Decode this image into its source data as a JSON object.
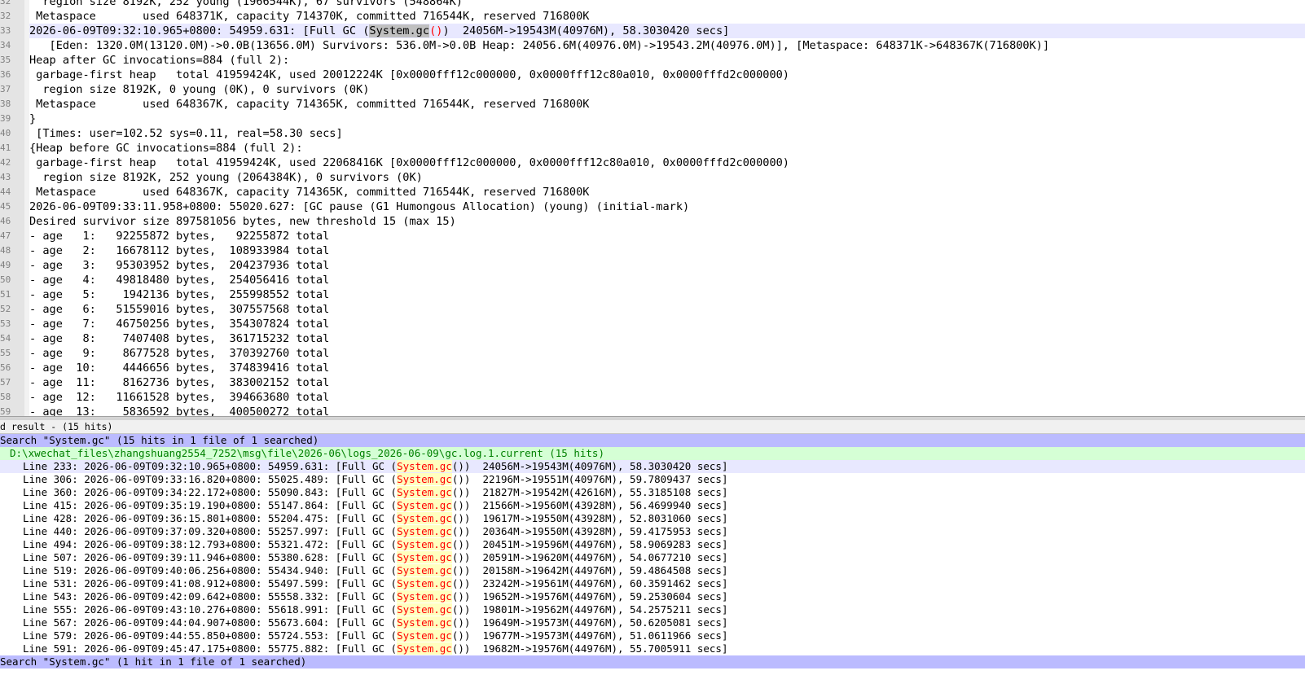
{
  "editor": {
    "current_line_number": "33",
    "lines": [
      {
        "n": "32",
        "text": "  region size 8192K, 252 young (1966544K), 67 survivors (548864K)"
      },
      {
        "n": "32",
        "text": " Metaspace       used 648371K, capacity 714370K, committed 716544K, reserved 716800K"
      },
      {
        "n": "33",
        "pre": "2026-06-09T09:32:10.965+0800: 54959.631: [Full GC (",
        "hl": "System.gc",
        "paren": "()",
        "post": ")  24056M->19543M(40976M), 58.3030420 secs]"
      },
      {
        "n": "34",
        "text": "   [Eden: 1320.0M(13120.0M)->0.0B(13656.0M) Survivors: 536.0M->0.0B Heap: 24056.6M(40976.0M)->19543.2M(40976.0M)], [Metaspace: 648371K->648367K(716800K)]"
      },
      {
        "n": "35",
        "text": "Heap after GC invocations=884 (full 2):"
      },
      {
        "n": "36",
        "text": " garbage-first heap   total 41959424K, used 20012224K [0x0000fff12c000000, 0x0000fff12c80a010, 0x0000fffd2c000000)"
      },
      {
        "n": "37",
        "text": "  region size 8192K, 0 young (0K), 0 survivors (0K)"
      },
      {
        "n": "38",
        "text": " Metaspace       used 648367K, capacity 714365K, committed 716544K, reserved 716800K"
      },
      {
        "n": "39",
        "text": "}"
      },
      {
        "n": "40",
        "text": " [Times: user=102.52 sys=0.11, real=58.30 secs]"
      },
      {
        "n": "41",
        "text": "{Heap before GC invocations=884 (full 2):"
      },
      {
        "n": "42",
        "text": " garbage-first heap   total 41959424K, used 22068416K [0x0000fff12c000000, 0x0000fff12c80a010, 0x0000fffd2c000000)"
      },
      {
        "n": "43",
        "text": "  region size 8192K, 252 young (2064384K), 0 survivors (0K)"
      },
      {
        "n": "44",
        "text": " Metaspace       used 648367K, capacity 714365K, committed 716544K, reserved 716800K"
      },
      {
        "n": "45",
        "text": "2026-06-09T09:33:11.958+0800: 55020.627: [GC pause (G1 Humongous Allocation) (young) (initial-mark)"
      },
      {
        "n": "46",
        "text": "Desired survivor size 897581056 bytes, new threshold 15 (max 15)"
      },
      {
        "n": "47",
        "text": "- age   1:   92255872 bytes,   92255872 total"
      },
      {
        "n": "48",
        "text": "- age   2:   16678112 bytes,  108933984 total"
      },
      {
        "n": "49",
        "text": "- age   3:   95303952 bytes,  204237936 total"
      },
      {
        "n": "50",
        "text": "- age   4:   49818480 bytes,  254056416 total"
      },
      {
        "n": "51",
        "text": "- age   5:    1942136 bytes,  255998552 total"
      },
      {
        "n": "52",
        "text": "- age   6:   51559016 bytes,  307557568 total"
      },
      {
        "n": "53",
        "text": "- age   7:   46750256 bytes,  354307824 total"
      },
      {
        "n": "54",
        "text": "- age   8:    7407408 bytes,  361715232 total"
      },
      {
        "n": "55",
        "text": "- age   9:    8677528 bytes,  370392760 total"
      },
      {
        "n": "56",
        "text": "- age  10:    4446656 bytes,  374839416 total"
      },
      {
        "n": "57",
        "text": "- age  11:    8162736 bytes,  383002152 total"
      },
      {
        "n": "58",
        "text": "- age  12:   11661528 bytes,  394663680 total"
      },
      {
        "n": "59",
        "text": "- age  13:    5836592 bytes,  400500272 total"
      }
    ]
  },
  "panel": {
    "title": "d result - (15 hits)"
  },
  "results": {
    "search1_header": "Search \"System.gc\" (15 hits in 1 file of 1 searched)",
    "file_header": "D:\\xwechat_files\\zhangshuang2554_7252\\msg\\file\\2026-06\\logs_2026-06-09\\gc.log.1.current (15 hits)",
    "match_text": "System.gc",
    "hits": [
      {
        "line": "Line 233:",
        "pre": " 2026-06-09T09:32:10.965+0800: 54959.631: [Full GC (",
        "post": "())  24056M->19543M(40976M), 58.3030420 secs]"
      },
      {
        "line": "Line 306:",
        "pre": " 2026-06-09T09:33:16.820+0800: 55025.489: [Full GC (",
        "post": "())  22196M->19551M(40976M), 59.7809437 secs]"
      },
      {
        "line": "Line 360:",
        "pre": " 2026-06-09T09:34:22.172+0800: 55090.843: [Full GC (",
        "post": "())  21827M->19542M(42616M), 55.3185108 secs]"
      },
      {
        "line": "Line 415:",
        "pre": " 2026-06-09T09:35:19.190+0800: 55147.864: [Full GC (",
        "post": "())  21566M->19560M(43928M), 56.4699940 secs]"
      },
      {
        "line": "Line 428:",
        "pre": " 2026-06-09T09:36:15.801+0800: 55204.475: [Full GC (",
        "post": "())  19617M->19550M(43928M), 52.8031060 secs]"
      },
      {
        "line": "Line 440:",
        "pre": " 2026-06-09T09:37:09.320+0800: 55257.997: [Full GC (",
        "post": "())  20364M->19550M(43928M), 59.4175953 secs]"
      },
      {
        "line": "Line 494:",
        "pre": " 2026-06-09T09:38:12.793+0800: 55321.472: [Full GC (",
        "post": "())  20451M->19596M(44976M), 58.9069283 secs]"
      },
      {
        "line": "Line 507:",
        "pre": " 2026-06-09T09:39:11.946+0800: 55380.628: [Full GC (",
        "post": "())  20591M->19620M(44976M), 54.0677210 secs]"
      },
      {
        "line": "Line 519:",
        "pre": " 2026-06-09T09:40:06.256+0800: 55434.940: [Full GC (",
        "post": "())  20158M->19642M(44976M), 59.4864508 secs]"
      },
      {
        "line": "Line 531:",
        "pre": " 2026-06-09T09:41:08.912+0800: 55497.599: [Full GC (",
        "post": "())  23242M->19561M(44976M), 60.3591462 secs]"
      },
      {
        "line": "Line 543:",
        "pre": " 2026-06-09T09:42:09.642+0800: 55558.332: [Full GC (",
        "post": "())  19652M->19576M(44976M), 59.2530604 secs]"
      },
      {
        "line": "Line 555:",
        "pre": " 2026-06-09T09:43:10.276+0800: 55618.991: [Full GC (",
        "post": "())  19801M->19562M(44976M), 54.2575211 secs]"
      },
      {
        "line": "Line 567:",
        "pre": " 2026-06-09T09:44:04.907+0800: 55673.604: [Full GC (",
        "post": "())  19649M->19573M(44976M), 50.6205081 secs]"
      },
      {
        "line": "Line 579:",
        "pre": " 2026-06-09T09:44:55.850+0800: 55724.553: [Full GC (",
        "post": "())  19677M->19573M(44976M), 51.0611966 secs]"
      },
      {
        "line": "Line 591:",
        "pre": " 2026-06-09T09:45:47.175+0800: 55775.882: [Full GC (",
        "post": "())  19682M->19576M(44976M), 55.7005911 secs]"
      }
    ],
    "search2_header": "Search \"System.gc\" (1 hit in 1 file of 1 searched)"
  },
  "colors": {
    "current_line": "#e8e8ff",
    "search_header_bg": "#bbbbff",
    "file_header_bg": "#d5ffd5",
    "match_fg": "#ff0000",
    "match_bg": "#ffffbf"
  }
}
